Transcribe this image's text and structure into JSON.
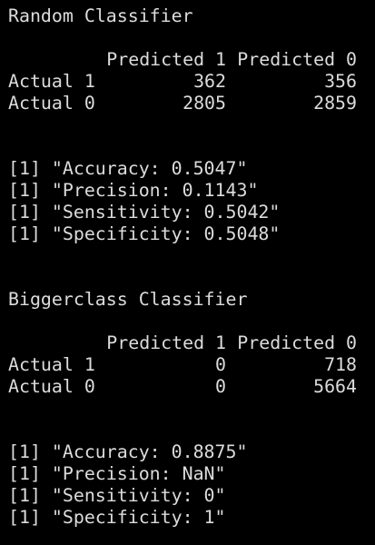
{
  "console": {
    "background": "#000000",
    "text_color": "#dcdcdc",
    "sections": [
      {
        "title": "Random Classifier",
        "headers": [
          "Predicted 1",
          "Predicted 0"
        ],
        "rows": [
          {
            "label": "Actual 1",
            "values": [
              "362",
              "356"
            ]
          },
          {
            "label": "Actual 0",
            "values": [
              "2805",
              "2859"
            ]
          }
        ],
        "metrics": [
          "[1] \"Accuracy: 0.5047\"",
          "[1] \"Precision: 0.1143\"",
          "[1] \"Sensitivity: 0.5042\"",
          "[1] \"Specificity: 0.5048\""
        ]
      },
      {
        "title": "Biggerclass Classifier",
        "headers": [
          "Predicted 1",
          "Predicted 0"
        ],
        "rows": [
          {
            "label": "Actual 1",
            "values": [
              "0",
              "718"
            ]
          },
          {
            "label": "Actual 0",
            "values": [
              "0",
              "5664"
            ]
          }
        ],
        "metrics": [
          "[1] \"Accuracy: 0.8875\"",
          "[1] \"Precision: NaN\"",
          "[1] \"Sensitivity: 0\"",
          "[1] \"Specificity: 1\""
        ]
      }
    ]
  }
}
